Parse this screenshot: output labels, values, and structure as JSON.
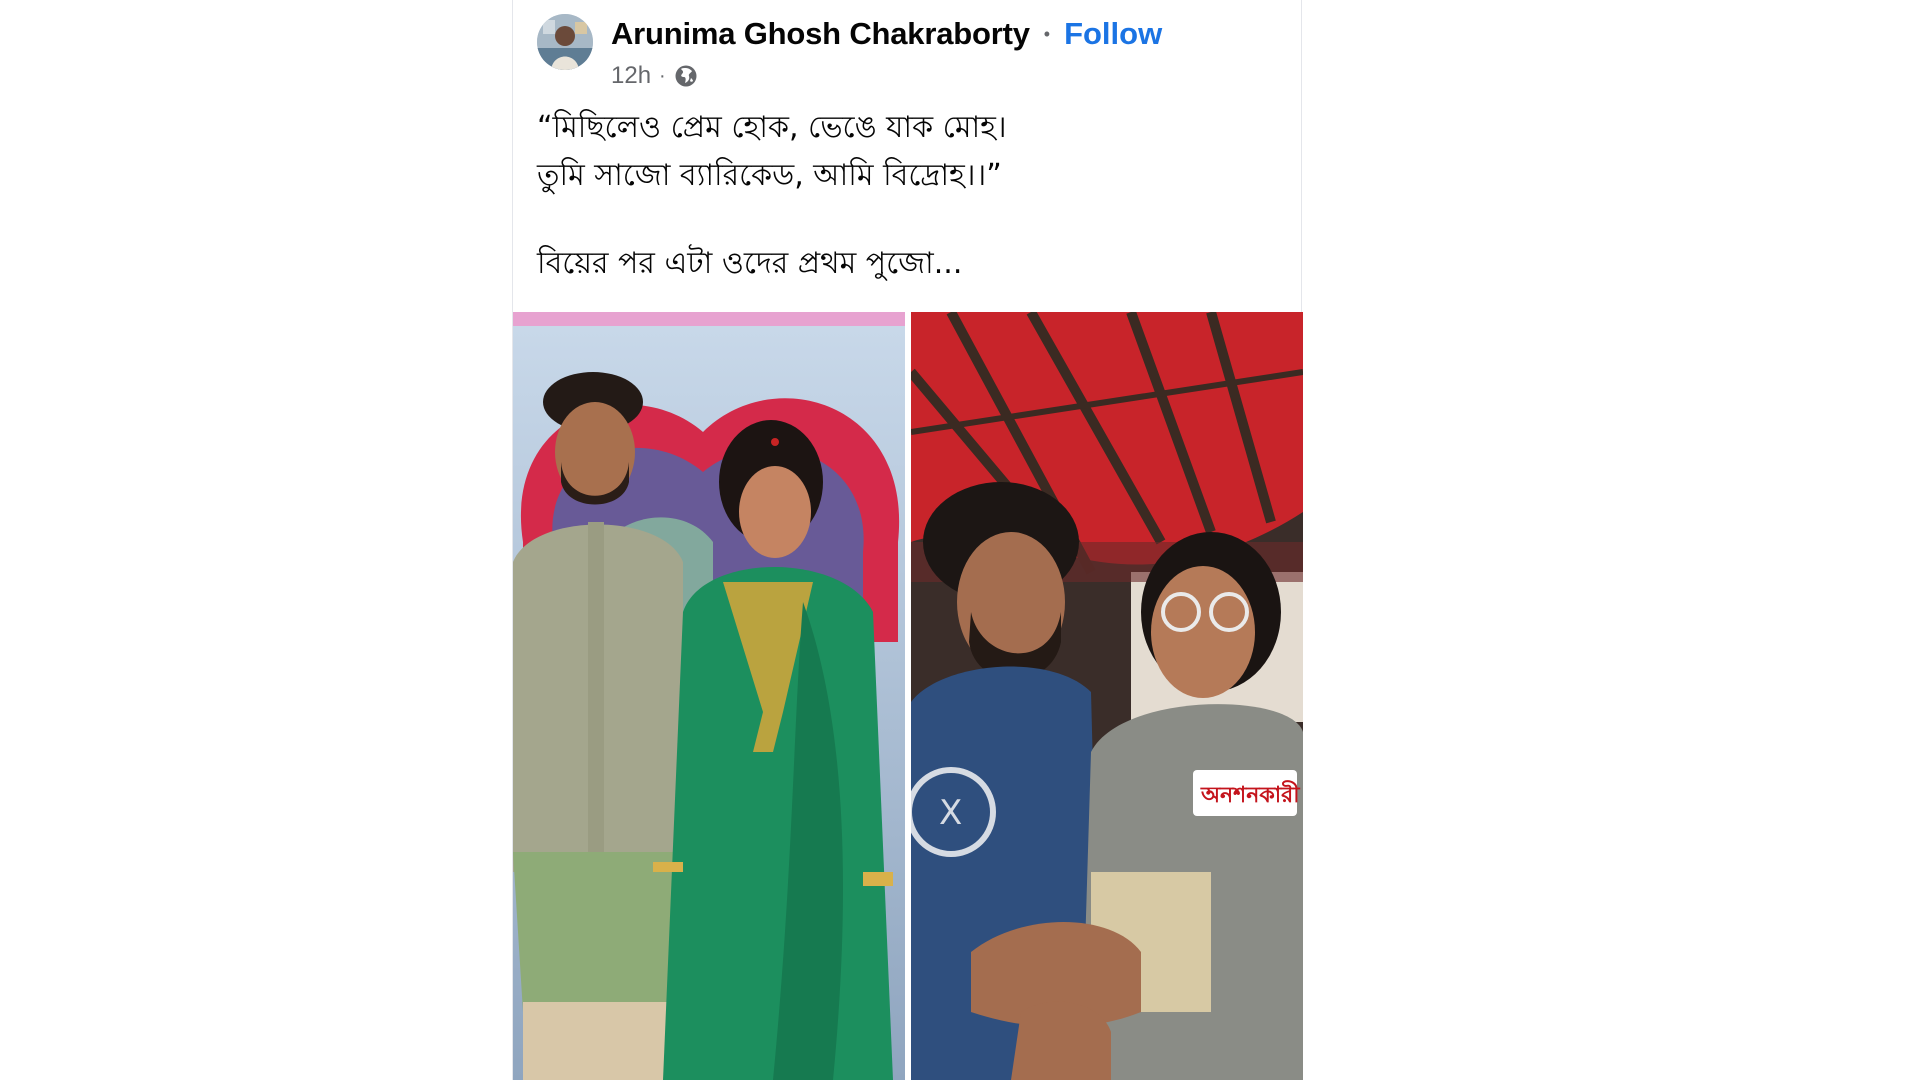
{
  "post": {
    "author": "Arunima Ghosh Chakraborty",
    "separator": "•",
    "follow_label": "Follow",
    "time": "12h",
    "meta_dot": "·",
    "audience_icon": "globe-icon",
    "text_lines": [
      "“মিছিলেও প্রেম হোক, ভেঙে যাক মোহ।",
      "তুমি সাজো ব্যারিকেড, আমি বিদ্রোহ।।”",
      "বিয়ের পর এটা ওদের প্রথম পুজো..."
    ]
  },
  "photos": {
    "left_description_icon": "wedding-photo",
    "right_description_icon": "protest-photo",
    "right_badge": "অনশনকারী"
  },
  "colors": {
    "accent": "#1b74e4",
    "text": "#050505",
    "secondary": "#65676b"
  }
}
